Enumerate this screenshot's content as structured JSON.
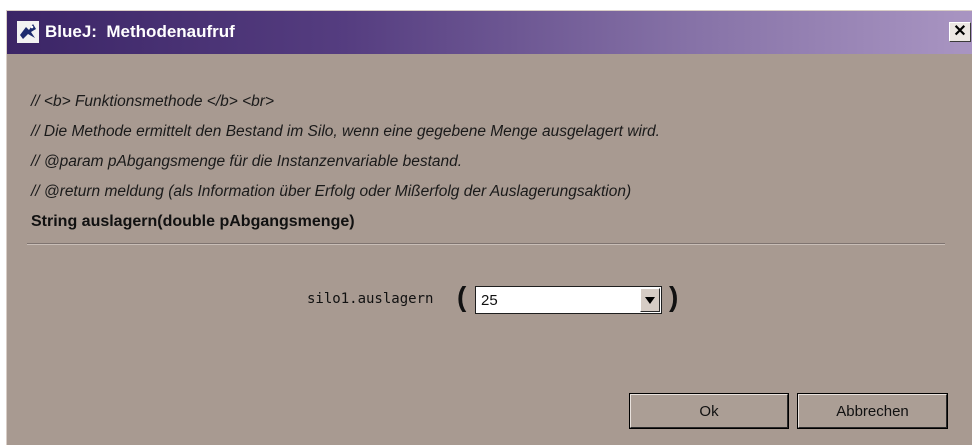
{
  "window": {
    "title": "BlueJ:  Methodenaufruf",
    "close_glyph": "✕",
    "app_icon": "bluej-bird-icon"
  },
  "comments": [
    "// <b> Funktionsmethode </b> <br>",
    "// Die Methode ermittelt den Bestand im Silo, wenn eine gegebene Menge ausgelagert wird.",
    "// @param pAbgangsmenge für die Instanzenvariable bestand.",
    "// @return meldung (als Information über Erfolg oder Mißerfolg der Auslagerungsaktion)"
  ],
  "signature": "String auslagern(double pAbgangsmenge)",
  "call": {
    "label": "silo1.auslagern",
    "open_paren": "(",
    "close_paren": ")",
    "argument_value": "25"
  },
  "buttons": {
    "ok": "Ok",
    "cancel": "Abbrechen"
  },
  "colors": {
    "dialog_background": "#a89a91",
    "titlebar_start": "#3b2566",
    "titlebar_end": "#a995c2"
  }
}
